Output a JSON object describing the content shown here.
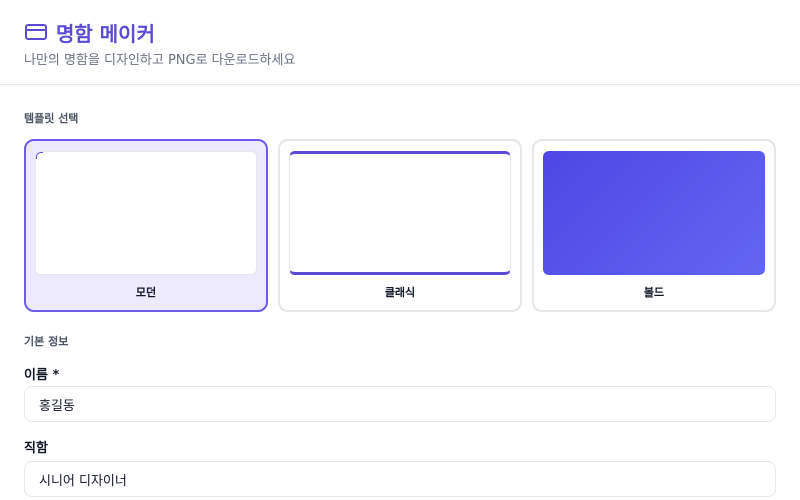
{
  "header": {
    "title": "명함 메이커",
    "subtitle": "나만의 명함을 디자인하고 PNG로 다운로드하세요",
    "icon": "card-icon",
    "accent_color": "#5b4bd4"
  },
  "templates": {
    "section_label": "템플릿 선택",
    "selected": "modern",
    "items": [
      {
        "id": "modern",
        "label": "모던"
      },
      {
        "id": "classic",
        "label": "클래식"
      },
      {
        "id": "bold",
        "label": "볼드"
      }
    ]
  },
  "basic_info": {
    "section_label": "기본 정보",
    "name_label": "이름 *",
    "name_value": "홍길동",
    "title_label": "직함",
    "title_value": "시니어 디자이너"
  }
}
